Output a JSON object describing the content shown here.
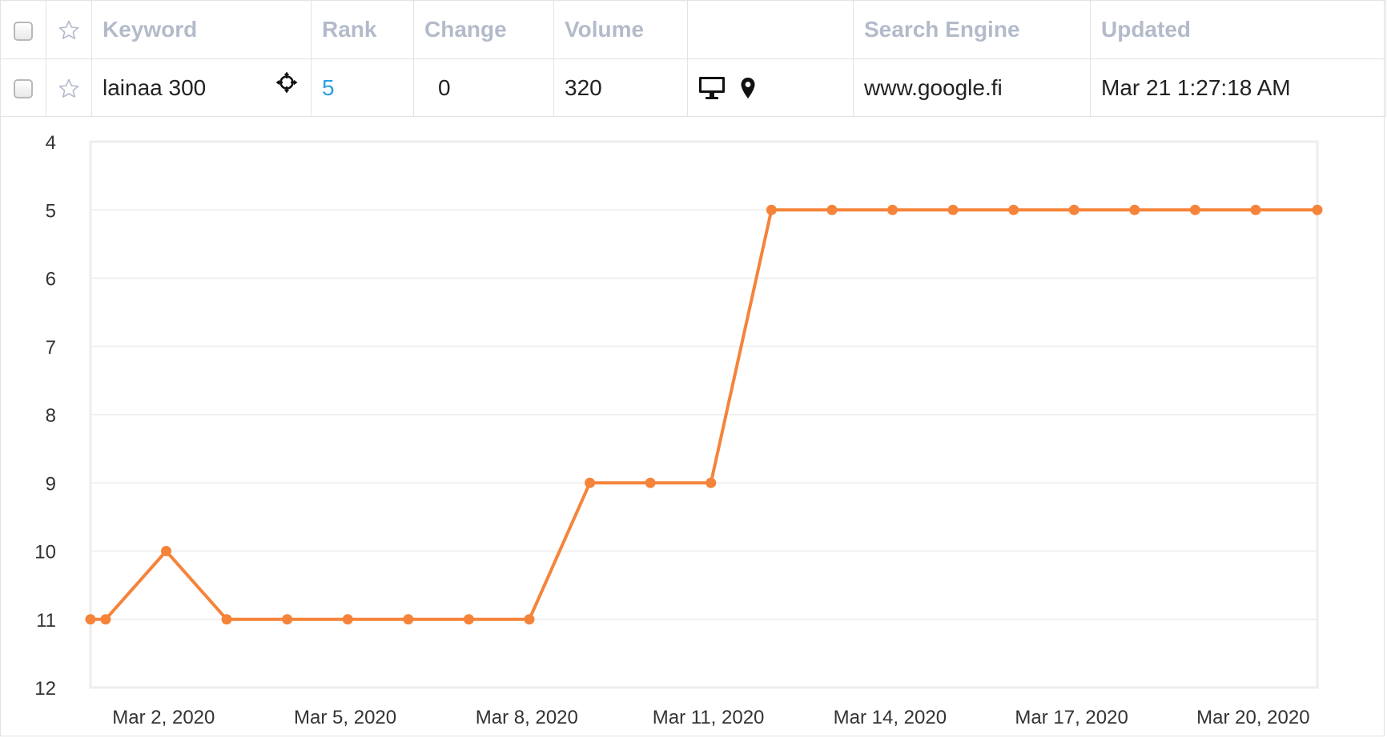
{
  "table": {
    "headers": {
      "keyword": "Keyword",
      "rank": "Rank",
      "change": "Change",
      "volume": "Volume",
      "device": "",
      "search_engine": "Search Engine",
      "updated": "Updated"
    },
    "row": {
      "keyword": "lainaa 300",
      "rank": "5",
      "change": "0",
      "volume": "320",
      "search_engine": "www.google.fi",
      "updated": "Mar 21 1:27:18 AM"
    },
    "icons": {
      "checkbox": "checkbox-icon",
      "star": "star-icon",
      "target": "target-icon",
      "device": "desktop-icon",
      "location": "location-pin-icon"
    }
  },
  "colors": {
    "accent": "#f5843a",
    "rank_link": "#2a9fe3",
    "header_text": "#b3bbca",
    "grid_line": "#ececec"
  },
  "chart_data": {
    "type": "line",
    "title": "",
    "xlabel": "",
    "ylabel": "",
    "y_reversed": true,
    "ylim": [
      4,
      12
    ],
    "yticks": [
      "4",
      "5",
      "6",
      "7",
      "8",
      "9",
      "10",
      "11",
      "12"
    ],
    "xlim": [
      "2020-02-29T19:00",
      "2020-03-21T01:27"
    ],
    "xticks": [
      {
        "date": "2020-03-02",
        "label": "Mar 2, 2020"
      },
      {
        "date": "2020-03-05",
        "label": "Mar 5, 2020"
      },
      {
        "date": "2020-03-08",
        "label": "Mar 8, 2020"
      },
      {
        "date": "2020-03-11",
        "label": "Mar 11, 2020"
      },
      {
        "date": "2020-03-14",
        "label": "Mar 14, 2020"
      },
      {
        "date": "2020-03-17",
        "label": "Mar 17, 2020"
      },
      {
        "date": "2020-03-20",
        "label": "Mar 20, 2020"
      }
    ],
    "grid": true,
    "series": [
      {
        "color": "#f5843a",
        "points": [
          {
            "x": "2020-02-29T19:00",
            "y": 11
          },
          {
            "x": "2020-03-01T01:00",
            "y": 11
          },
          {
            "x": "2020-03-02T01:00",
            "y": 10
          },
          {
            "x": "2020-03-03T01:00",
            "y": 11
          },
          {
            "x": "2020-03-04T01:00",
            "y": 11
          },
          {
            "x": "2020-03-05T01:00",
            "y": 11
          },
          {
            "x": "2020-03-06T01:00",
            "y": 11
          },
          {
            "x": "2020-03-07T01:00",
            "y": 11
          },
          {
            "x": "2020-03-08T01:00",
            "y": 11
          },
          {
            "x": "2020-03-09T01:00",
            "y": 9
          },
          {
            "x": "2020-03-10T01:00",
            "y": 9
          },
          {
            "x": "2020-03-11T01:00",
            "y": 9
          },
          {
            "x": "2020-03-12T01:00",
            "y": 5
          },
          {
            "x": "2020-03-13T01:00",
            "y": 5
          },
          {
            "x": "2020-03-14T01:00",
            "y": 5
          },
          {
            "x": "2020-03-15T01:00",
            "y": 5
          },
          {
            "x": "2020-03-16T01:00",
            "y": 5
          },
          {
            "x": "2020-03-17T01:00",
            "y": 5
          },
          {
            "x": "2020-03-18T01:00",
            "y": 5
          },
          {
            "x": "2020-03-19T01:00",
            "y": 5
          },
          {
            "x": "2020-03-20T01:00",
            "y": 5
          },
          {
            "x": "2020-03-21T01:27",
            "y": 5
          }
        ]
      }
    ]
  }
}
